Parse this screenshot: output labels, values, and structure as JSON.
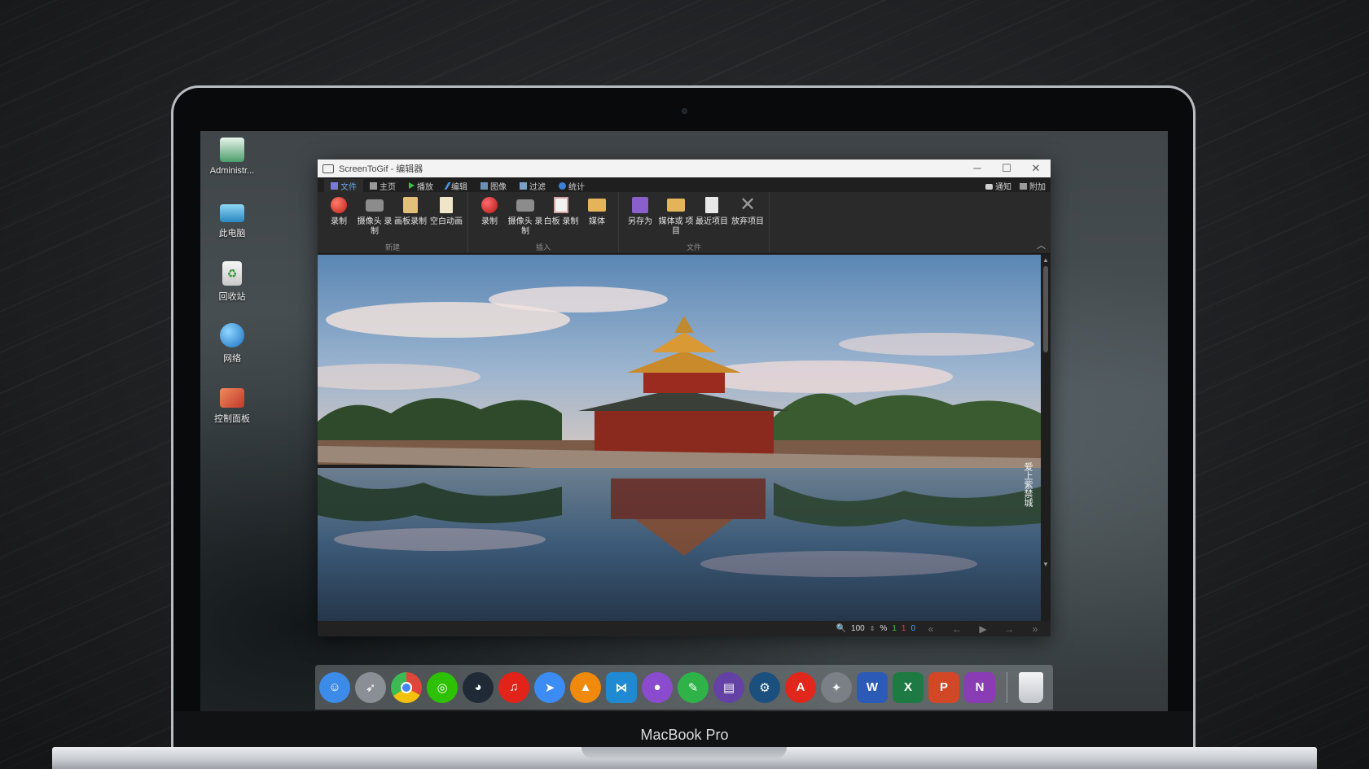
{
  "desktop": {
    "icons": [
      {
        "label": "Administr...",
        "icon": "user-icon",
        "color": "#4c9d6b"
      },
      {
        "label": "此电脑",
        "icon": "computer-icon",
        "color": "#3aa7d6"
      },
      {
        "label": "回收站",
        "icon": "recycle-bin-icon",
        "color": "#e8e8e8"
      },
      {
        "label": "网络",
        "icon": "network-globe-icon",
        "color": "#2a8fd8"
      },
      {
        "label": "控制面板",
        "icon": "control-panel-icon",
        "color": "#d2563c"
      }
    ]
  },
  "window": {
    "title": "ScreenToGif - 编辑器",
    "controls": {
      "minimize": "─",
      "maximize": "☐",
      "close": "✕"
    },
    "tabs": [
      {
        "label": "文件",
        "icon": "save-icon",
        "active": true
      },
      {
        "label": "主页",
        "icon": "home-icon",
        "active": false
      },
      {
        "label": "播放",
        "icon": "play-icon",
        "active": false
      },
      {
        "label": "编辑",
        "icon": "edit-icon",
        "active": false
      },
      {
        "label": "图像",
        "icon": "image-icon",
        "active": false
      },
      {
        "label": "过滤",
        "icon": "filter-icon",
        "active": false
      },
      {
        "label": "统计",
        "icon": "info-icon",
        "active": false
      }
    ],
    "tab_right": {
      "notify": "通知",
      "extras": "附加"
    },
    "ribbon": {
      "groups": [
        {
          "label": "新建",
          "buttons": [
            {
              "label": "录制",
              "icon": "record-icon"
            },
            {
              "label": "摄像头 录制",
              "icon": "camera-icon"
            },
            {
              "label": "画板录制",
              "icon": "board-record-icon"
            },
            {
              "label": "空白动画",
              "icon": "blank-file-icon"
            }
          ]
        },
        {
          "label": "插入",
          "buttons": [
            {
              "label": "录制",
              "icon": "record-add-icon"
            },
            {
              "label": "摄像头 录制",
              "icon": "camera-icon"
            },
            {
              "label": "白板 录制",
              "icon": "whiteboard-icon"
            },
            {
              "label": "媒体",
              "icon": "folder-icon"
            }
          ]
        },
        {
          "label": "文件",
          "buttons": [
            {
              "label": "另存为",
              "icon": "floppy-save-icon"
            },
            {
              "label": "媒体或 项目",
              "icon": "open-folder-icon"
            },
            {
              "label": "最近项目",
              "icon": "recent-file-icon"
            },
            {
              "label": "放弃项目",
              "icon": "discard-x-icon"
            }
          ]
        }
      ]
    },
    "canvas": {
      "watermark": "爱上紫禁城"
    },
    "status": {
      "zoom": "100",
      "zoom_unit": "%",
      "frames_a": "1",
      "frames_b": "1",
      "frames_c": "0"
    }
  },
  "dock": {
    "apps": [
      {
        "name": "finder-icon",
        "color": "#3d8be8"
      },
      {
        "name": "launchpad-rocket-icon",
        "color": "#8a8f96"
      },
      {
        "name": "chrome-icon",
        "color": "#e1463a"
      },
      {
        "name": "wechat-icon",
        "color": "#2dc100"
      },
      {
        "name": "qq-penguin-icon",
        "color": "#1f2a36"
      },
      {
        "name": "netease-music-icon",
        "color": "#e2231a"
      },
      {
        "name": "feishu-icon",
        "color": "#3c8cf5"
      },
      {
        "name": "vlc-cone-icon",
        "color": "#f08a0c"
      },
      {
        "name": "vscode-icon",
        "color": "#1f8ad2"
      },
      {
        "name": "github-icon",
        "color": "#8a4bcf"
      },
      {
        "name": "evernote-icon",
        "color": "#2fb348"
      },
      {
        "name": "twitch-icon",
        "color": "#6441a5"
      },
      {
        "name": "steam-icon",
        "color": "#1b4f7e"
      },
      {
        "name": "acrobat-icon",
        "color": "#e1261c"
      },
      {
        "name": "inkscape-icon",
        "color": "#7b7f86"
      },
      {
        "name": "word-icon",
        "color": "#2b5bb7"
      },
      {
        "name": "excel-icon",
        "color": "#1d7a43"
      },
      {
        "name": "powerpoint-icon",
        "color": "#d24726"
      },
      {
        "name": "onenote-icon",
        "color": "#8a3cb5"
      }
    ],
    "trash": {
      "name": "trash-icon",
      "color": "#d8dadd"
    }
  },
  "device": {
    "label": "MacBook Pro"
  }
}
